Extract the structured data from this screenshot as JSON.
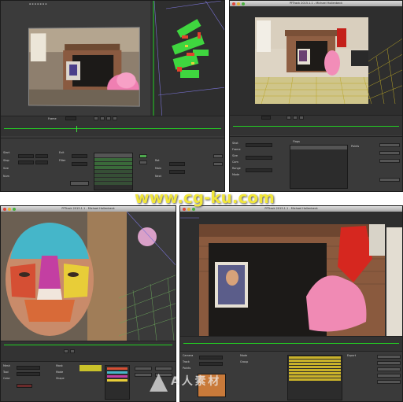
{
  "colors": {
    "timeline_green": "#23d023",
    "watermark": "#f2e73a",
    "ui_dark": "#3b3b3b"
  },
  "panels": [
    {
      "id": "p1",
      "title": "",
      "tl_label": "Frame",
      "labels": [
        "Start",
        "Stop",
        "Size",
        "Num",
        "Exit",
        "Filter",
        "Rot",
        "Main",
        "Next"
      ]
    },
    {
      "id": "p2",
      "title": "PFTrack 2015.1.1 - Michael Hollenbeck",
      "labels": [
        "Shot",
        "Frame",
        "Size",
        "Cam",
        "Range",
        "Mode",
        "Flags",
        "Points"
      ]
    },
    {
      "id": "p3",
      "title": "PFTrack 2015.1.1 - Michael Hollenbeck",
      "labels": [
        "Mesh",
        "Tool",
        "Color",
        "Mask",
        "Mode",
        "Shape"
      ]
    },
    {
      "id": "p4",
      "title": "PFTrack 2015.1.1 - Michael Hollenbeck",
      "labels": [
        "Camera",
        "Track",
        "Points",
        "Mode",
        "Group",
        "Export"
      ]
    }
  ],
  "watermark": "www.cg-ku.com",
  "logo": {
    "mark_glyph": "▲",
    "text": "A 人 素 材"
  }
}
